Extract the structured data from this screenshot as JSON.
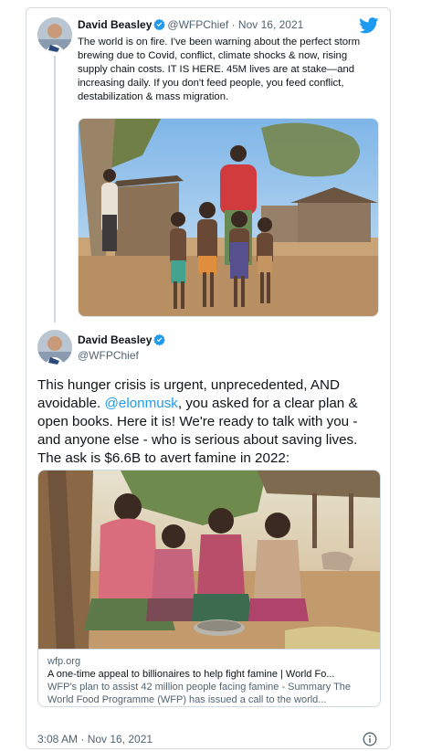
{
  "quoted_tweet": {
    "author_name": "David Beasley",
    "handle": "@WFPChief",
    "separator": " · ",
    "date": "Nov 16, 2021",
    "text": "The world is on fire. I've been warning about the perfect storm brewing due to Covid, conflict, climate shocks & now, rising supply chain costs. IT IS HERE. 45M lives are at stake—and increasing daily. If you don't feed people, you feed conflict, destabilization & mass migration."
  },
  "main_tweet": {
    "author_name": "David Beasley",
    "handle": "@WFPChief",
    "text_before": "This hunger crisis is urgent, unprecedented, AND avoidable. ",
    "mention": "@elonmusk",
    "text_after": ", you asked for a clear plan & open books. Here it is! We're ready to talk with you - and anyone else - who is serious about saving lives. The ask is $6.6B to avert famine in 2022:",
    "timestamp": "3:08 AM · Nov 16, 2021"
  },
  "link_card": {
    "domain": "wfp.org",
    "title": "A one-time appeal to billionaires to help fight famine | World Fo...",
    "description": "WFP's plan to assist 42 million people facing famine - Summary The World Food Programme (WFP) has issued a call to the world..."
  },
  "icons": {
    "verified": "verified-badge-icon",
    "brand": "twitter-bird-icon",
    "info": "info-icon"
  },
  "colors": {
    "accent": "#1d9bf0",
    "text": "#0f1419",
    "muted": "#536471",
    "border": "#cfd9de"
  }
}
